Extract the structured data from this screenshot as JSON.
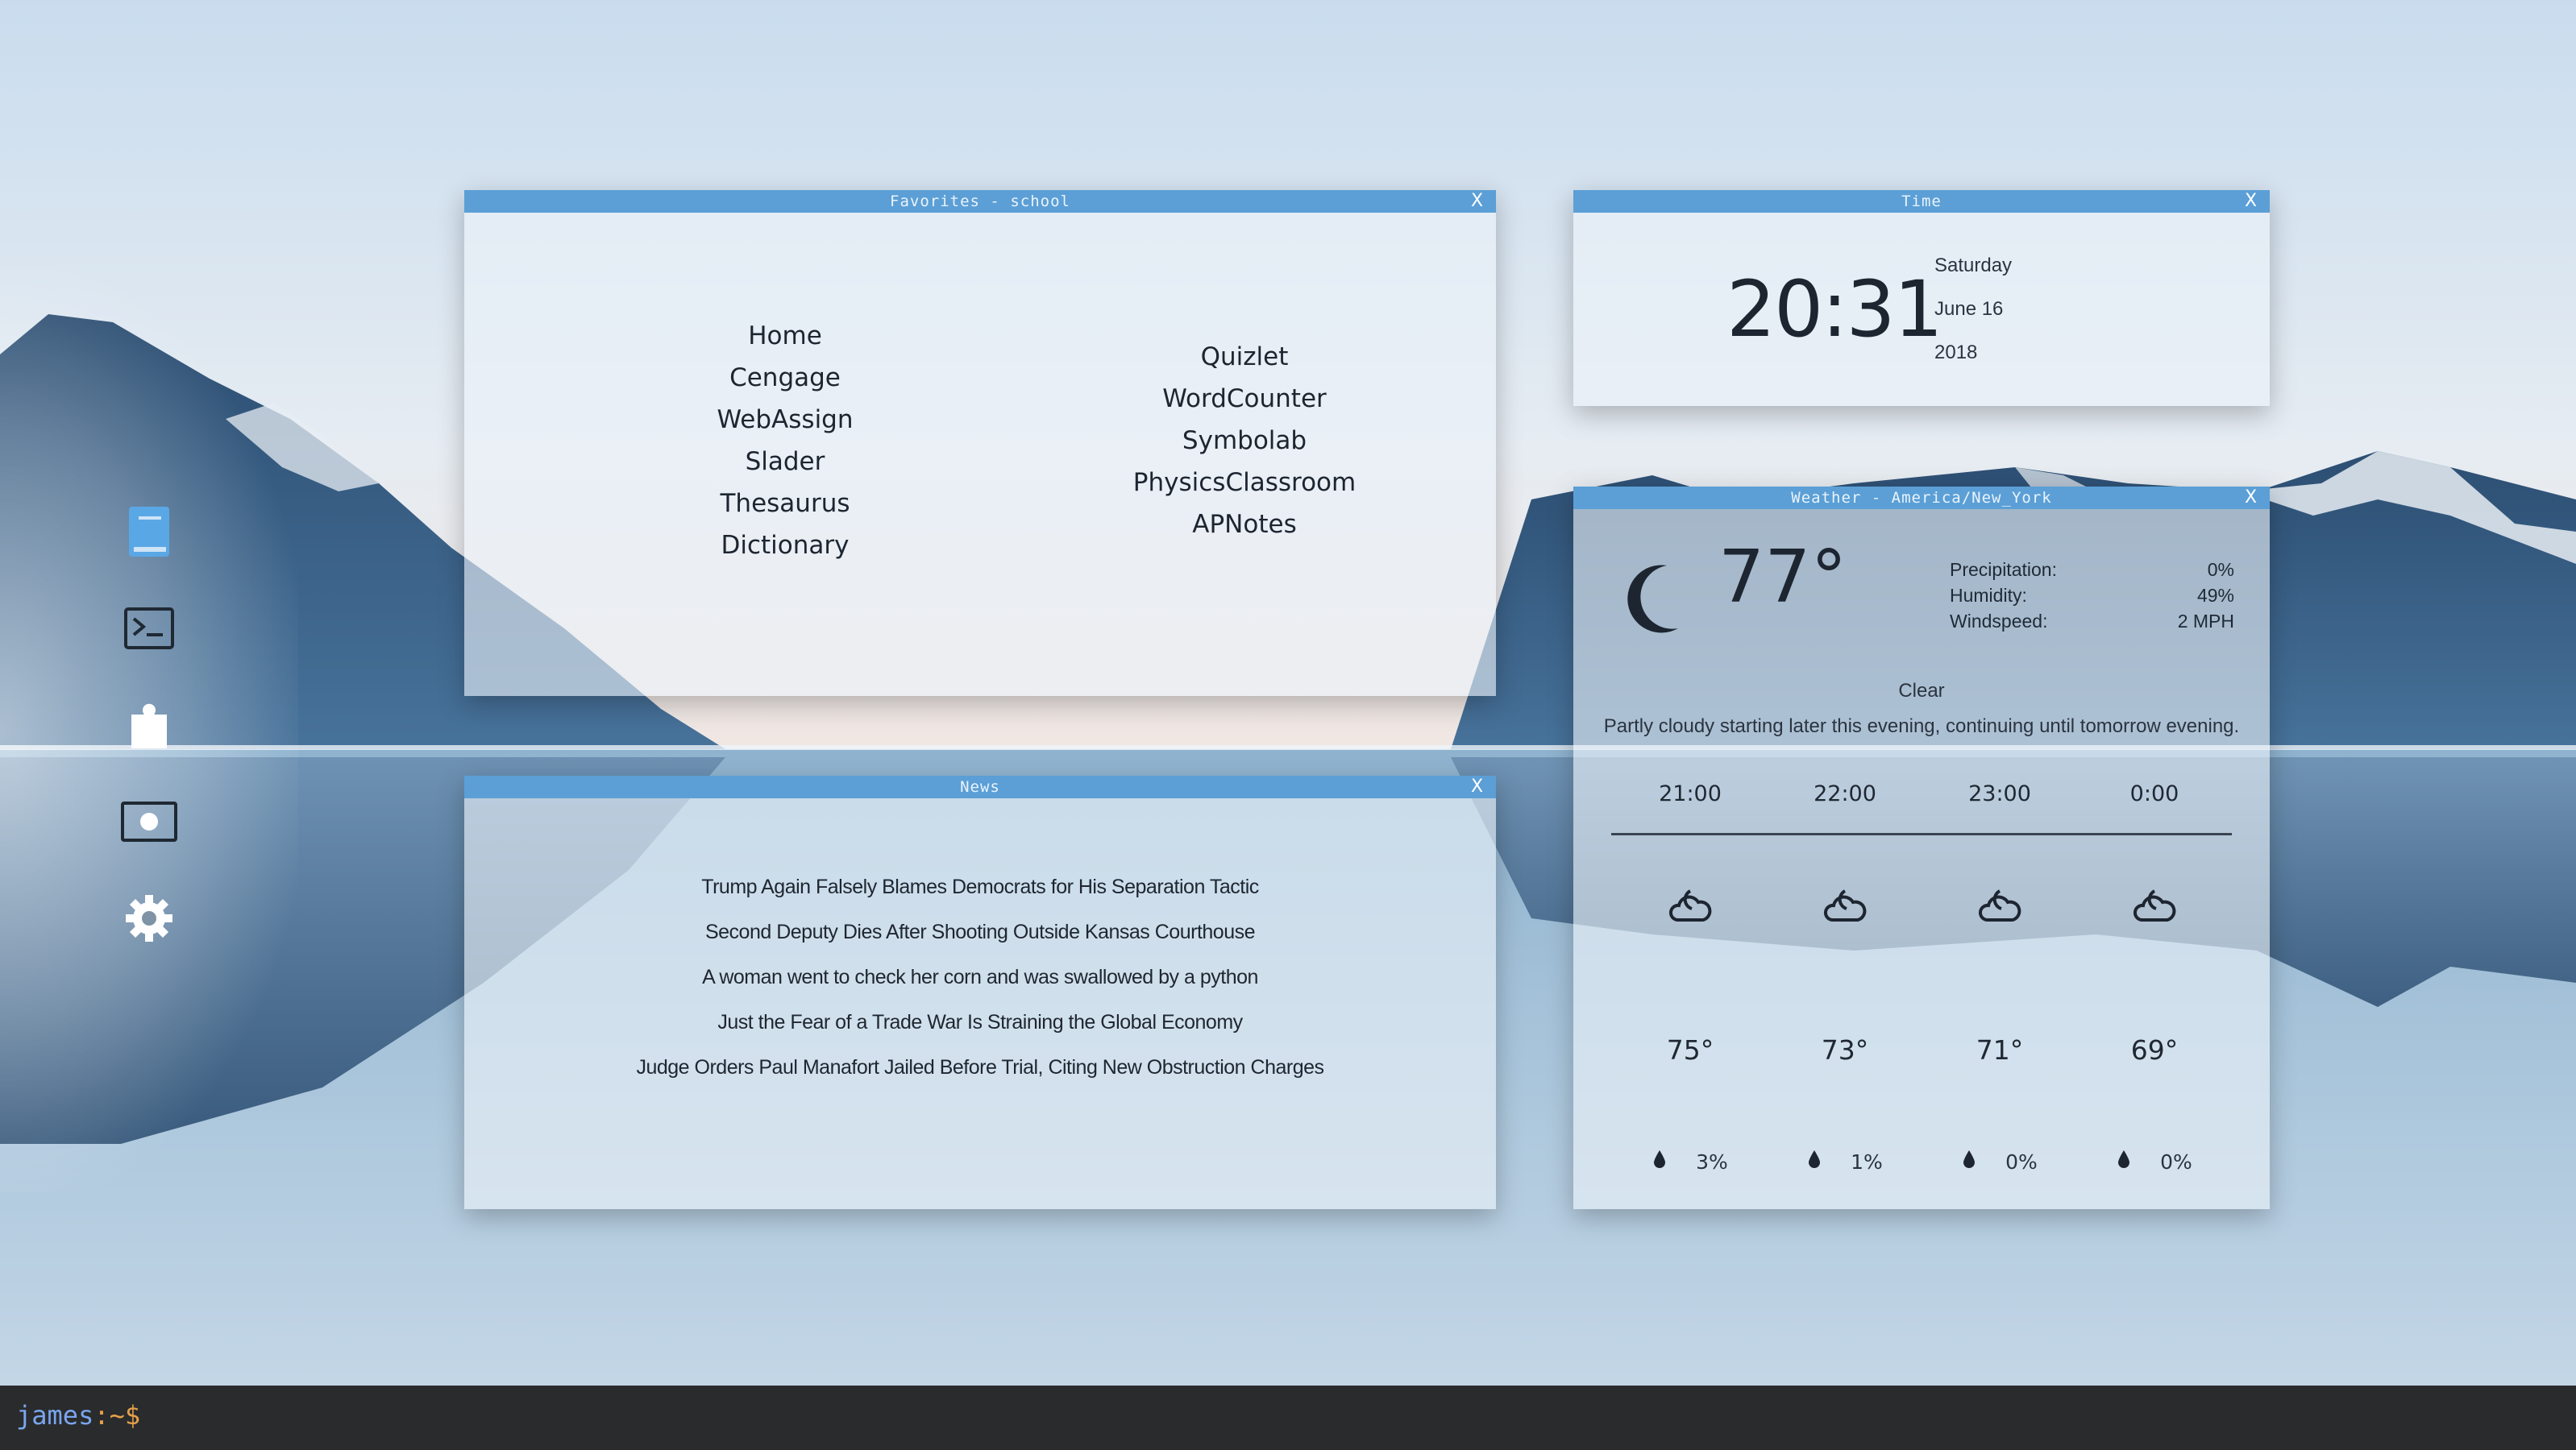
{
  "colors": {
    "title_bar": "#5b9fd6",
    "prompt_user": "#7aa6f0",
    "prompt_symbol": "#e5a04a",
    "taskbar": "#2a2b2c"
  },
  "dock": {
    "items": [
      {
        "icon": "book-icon"
      },
      {
        "icon": "terminal-icon"
      },
      {
        "icon": "puzzle-piece-icon"
      },
      {
        "icon": "record-icon"
      },
      {
        "icon": "gear-icon"
      }
    ]
  },
  "favorites": {
    "title": "Favorites - school",
    "close": "X",
    "left_links": [
      "Home",
      "Cengage",
      "WebAssign",
      "Slader",
      "Thesaurus",
      "Dictionary"
    ],
    "right_links": [
      "Quizlet",
      "WordCounter",
      "Symbolab",
      "PhysicsClassroom",
      "APNotes"
    ]
  },
  "news": {
    "title": "News",
    "close": "X",
    "headlines": [
      "Trump Again Falsely Blames Democrats for His Separation Tactic",
      "Second Deputy Dies After Shooting Outside Kansas Courthouse",
      "A woman went to check her corn  and was swallowed by a python",
      "Just the Fear of a Trade War Is Straining the Global Economy",
      "Judge Orders Paul Manafort Jailed Before Trial, Citing New Obstruction Charges"
    ]
  },
  "time": {
    "title": "Time",
    "close": "X",
    "clock": "20:31",
    "day": "Saturday",
    "date": "June 16",
    "year": "2018"
  },
  "weather": {
    "title": "Weather - America/New_York",
    "close": "X",
    "current_icon": "moon-icon",
    "temperature": "77°",
    "stats": [
      {
        "label": "Precipitation:",
        "value": "0%"
      },
      {
        "label": "Humidity:",
        "value": "49%"
      },
      {
        "label": "Windspeed:",
        "value": "2 MPH"
      }
    ],
    "condition": "Clear",
    "summary": "Partly cloudy starting later this evening, continuing until tomorrow evening.",
    "hourly": [
      {
        "time": "21:00",
        "icon": "partly-cloudy-night-icon",
        "temp": "75°",
        "precip": "3%"
      },
      {
        "time": "22:00",
        "icon": "partly-cloudy-night-icon",
        "temp": "73°",
        "precip": "1%"
      },
      {
        "time": "23:00",
        "icon": "partly-cloudy-night-icon",
        "temp": "71°",
        "precip": "0%"
      },
      {
        "time": "0:00",
        "icon": "partly-cloudy-night-icon",
        "temp": "69°",
        "precip": "0%"
      }
    ]
  },
  "taskbar": {
    "user": "james",
    "path": ":~$"
  }
}
